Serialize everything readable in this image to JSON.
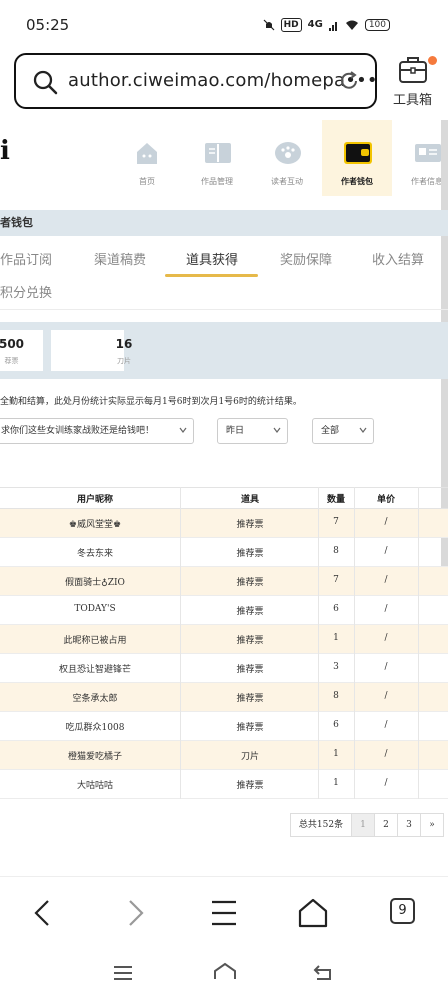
{
  "status": {
    "time": "05:25",
    "hd": "HD",
    "network": "4G",
    "battery": "100"
  },
  "browser": {
    "url": "author.ciweimao.com/homepa•••",
    "toolbox_label": "工具箱",
    "tab_count": "9"
  },
  "logo_fragment": "i",
  "top_nav": [
    {
      "label": "首页",
      "icon": "home-icon"
    },
    {
      "label": "作品管理",
      "icon": "book-icon"
    },
    {
      "label": "读者互动",
      "icon": "paw-chat-icon"
    },
    {
      "label": "作者钱包",
      "icon": "wallet-icon",
      "active": true
    },
    {
      "label": "作者信息",
      "icon": "id-card-icon"
    }
  ],
  "section_title": "者钱包",
  "tabs": [
    "作品订阅",
    "渠道稿费",
    "道具获得",
    "奖励保障",
    "收入结算",
    "积分兑换"
  ],
  "active_tab": "道具获得",
  "stats": [
    {
      "value": "500",
      "label": "荐票"
    },
    {
      "value": "16",
      "label": "刀片"
    }
  ],
  "notice": "全勤和结算，此处月份统计实际显示每月1号6时到次月1号6时的统计结果。",
  "filters": {
    "message": "求你们这些女训练家战败还是给钱吧！",
    "period": "昨日",
    "type": "全部"
  },
  "table": {
    "headers": [
      "用户昵称",
      "道具",
      "数量",
      "单价"
    ],
    "rows": [
      {
        "user": "♚威风堂堂♚",
        "item": "推荐票",
        "qty": "7",
        "price": "/"
      },
      {
        "user": "冬去东来",
        "item": "推荐票",
        "qty": "8",
        "price": "/"
      },
      {
        "user": "假面骑士♁ZIO",
        "item": "推荐票",
        "qty": "7",
        "price": "/"
      },
      {
        "user": "TODAY'S",
        "item": "推荐票",
        "qty": "6",
        "price": "/"
      },
      {
        "user": "此昵称已被占用",
        "item": "推荐票",
        "qty": "1",
        "price": "/"
      },
      {
        "user": "权且恐让智避锋芒",
        "item": "推荐票",
        "qty": "3",
        "price": "/"
      },
      {
        "user": "空条承太郎",
        "item": "推荐票",
        "qty": "8",
        "price": "/"
      },
      {
        "user": "吃瓜群众1008",
        "item": "推荐票",
        "qty": "6",
        "price": "/"
      },
      {
        "user": "橙猫爱吃橘子",
        "item": "刀片",
        "qty": "1",
        "price": "/"
      },
      {
        "user": "大咕咕咕",
        "item": "推荐票",
        "qty": "1",
        "price": "/"
      }
    ]
  },
  "pagination": {
    "total": "总共152条",
    "pages": [
      "1",
      "2",
      "3"
    ],
    "next": "»",
    "current": "1"
  },
  "colors": {
    "accent": "#e6b94a",
    "row_alt": "#fdf4e4",
    "band": "#dde6ec",
    "active_nav": "#fdf4de"
  }
}
